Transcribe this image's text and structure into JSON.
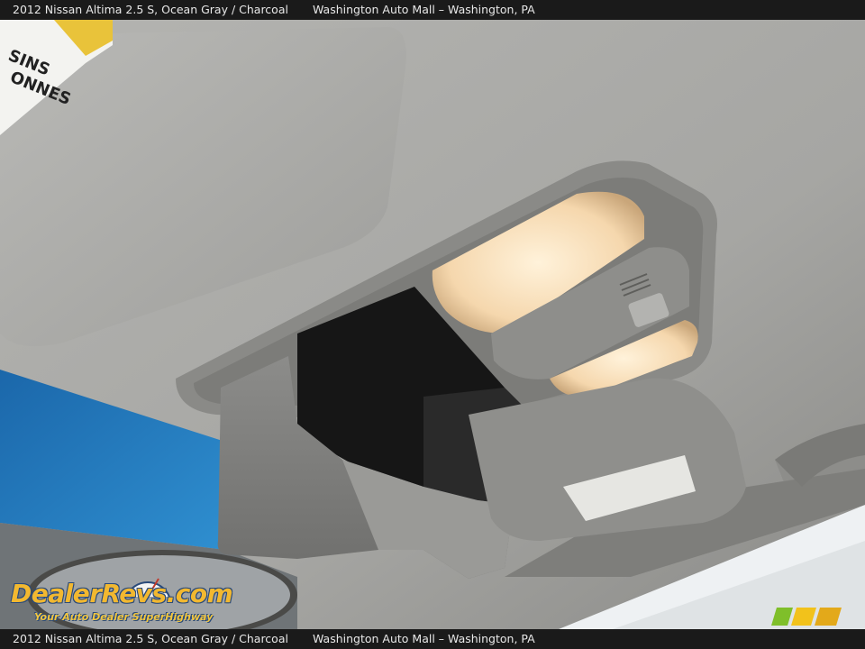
{
  "header": {
    "vehicle": "2012 Nissan Altima 2.5 S,  Ocean Gray / Charcoal",
    "dealer": "Washington Auto Mall – Washington, PA"
  },
  "footer": {
    "vehicle": "2012 Nissan Altima 2.5 S,  Ocean Gray / Charcoal",
    "dealer": "Washington Auto Mall – Washington, PA"
  },
  "watermark": {
    "brand": "DealerRevs.com",
    "tagline": "Your Auto Dealer SuperHighway"
  },
  "visor_label": {
    "lines": [
      "SINS",
      "ONNES"
    ]
  },
  "icons": {
    "watermark_logo": "dealerrevs-logo",
    "dealer_logo": "wam-logo",
    "gauge": "speedometer-icon"
  },
  "colors": {
    "headliner": "#a9a9a6",
    "bar": "#1a1a1a",
    "lamp": "#f7dcb8",
    "window_blue": "#1f6fb4"
  }
}
